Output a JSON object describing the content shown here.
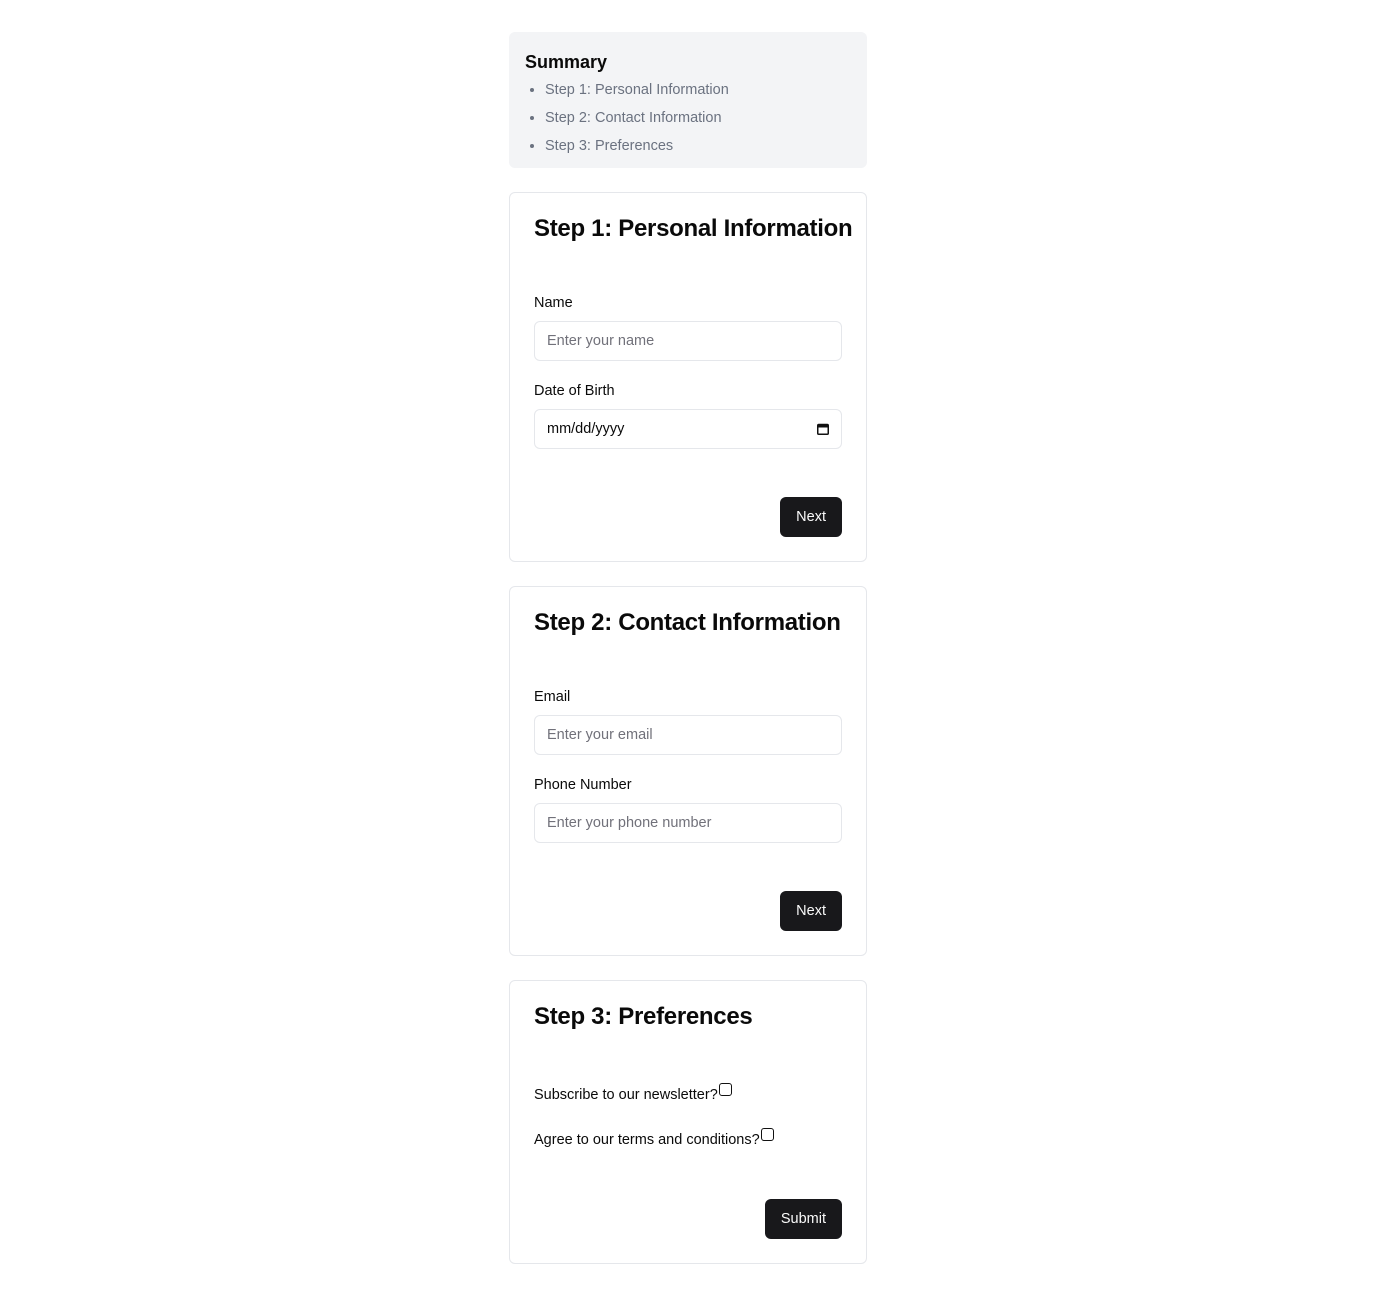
{
  "summary": {
    "title": "Summary",
    "items": [
      "Step 1: Personal Information",
      "Step 2: Contact Information",
      "Step 3: Preferences"
    ]
  },
  "step1": {
    "title": "Step 1: Personal Information",
    "name_label": "Name",
    "name_placeholder": "Enter your name",
    "dob_label": "Date of Birth",
    "dob_placeholder": "mm/dd/yyyy",
    "next_label": "Next"
  },
  "step2": {
    "title": "Step 2: Contact Information",
    "email_label": "Email",
    "email_placeholder": "Enter your email",
    "phone_label": "Phone Number",
    "phone_placeholder": "Enter your phone number",
    "next_label": "Next"
  },
  "step3": {
    "title": "Step 3: Preferences",
    "newsletter_label": "Subscribe to our newsletter?",
    "terms_label": "Agree to our terms and conditions?",
    "submit_label": "Submit"
  },
  "icons": {
    "calendar": "calendar-icon"
  },
  "colors": {
    "primary_button": "#18181b",
    "summary_bg": "#f3f4f6",
    "muted_text": "#6b7280"
  }
}
